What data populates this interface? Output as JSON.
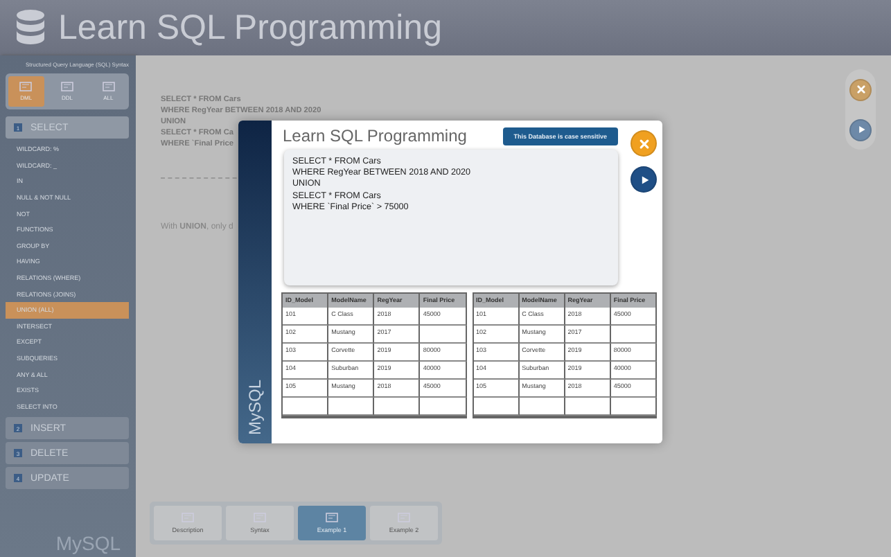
{
  "header": {
    "title": "Learn SQL Programming"
  },
  "sidebar": {
    "caption": "Structured Query Language (SQL) Syntax",
    "segments": [
      {
        "label": "DML",
        "selected": true
      },
      {
        "label": "DDL",
        "selected": false
      },
      {
        "label": "ALL",
        "selected": false
      }
    ],
    "sections": [
      {
        "number": "1",
        "label": "SELECT",
        "expanded": true,
        "items": [
          {
            "label": "WILDCARD: %",
            "selected": false
          },
          {
            "label": "WILDCARD: _",
            "selected": false
          },
          {
            "label": "IN",
            "selected": false
          },
          {
            "label": "NULL  &  NOT NULL",
            "selected": false
          },
          {
            "label": "NOT",
            "selected": false
          },
          {
            "label": "FUNCTIONS",
            "selected": false
          },
          {
            "label": "GROUP BY",
            "selected": false
          },
          {
            "label": "HAVING",
            "selected": false
          },
          {
            "label": "RELATIONS (WHERE)",
            "selected": false
          },
          {
            "label": "RELATIONS (JOINS)",
            "selected": false
          },
          {
            "label": "UNION (ALL)",
            "selected": true
          },
          {
            "label": "INTERSECT",
            "selected": false
          },
          {
            "label": "EXCEPT",
            "selected": false
          },
          {
            "label": "SUBQUERIES",
            "selected": false
          },
          {
            "label": "ANY  &  ALL",
            "selected": false
          },
          {
            "label": "EXISTS",
            "selected": false
          },
          {
            "label": "SELECT INTO",
            "selected": false
          }
        ]
      },
      {
        "number": "2",
        "label": "INSERT",
        "expanded": false
      },
      {
        "number": "3",
        "label": "DELETE",
        "expanded": false
      },
      {
        "number": "4",
        "label": "UPDATE",
        "expanded": false
      }
    ],
    "footer": "MySQL"
  },
  "main": {
    "code": [
      "SELECT * FROM Cars",
      "WHERE RegYear BETWEEN 2018 AND 2020",
      "UNION",
      "SELECT * FROM Ca",
      "WHERE `Final Price"
    ],
    "description": "With **UNION**, only d",
    "tabs": [
      {
        "label": "Description",
        "selected": false
      },
      {
        "label": "Syntax",
        "selected": false
      },
      {
        "label": "Example 1",
        "selected": true
      },
      {
        "label": "Example 2",
        "selected": false
      }
    ]
  },
  "modal": {
    "side_label": "MySQL",
    "title": "Learn SQL Programming",
    "badge": "This Database is case sensitive",
    "code": [
      "SELECT * FROM Cars",
      "WHERE RegYear BETWEEN 2018 AND 2020",
      "UNION",
      "SELECT * FROM Cars",
      "WHERE `Final Price` > 75000"
    ],
    "tables": [
      {
        "columns": [
          "ID_Model",
          "ModelName",
          "RegYear",
          "Final Price"
        ],
        "rows": [
          [
            "101",
            "C Class",
            "2018",
            "45000"
          ],
          [
            "102",
            "Mustang",
            "2017",
            ""
          ],
          [
            "103",
            "Corvette",
            "2019",
            "80000"
          ],
          [
            "104",
            "Suburban",
            "2019",
            "40000"
          ],
          [
            "105",
            "Mustang",
            "2018",
            "45000"
          ]
        ]
      },
      {
        "columns": [
          "ID_Model",
          "ModelName",
          "RegYear",
          "Final Price"
        ],
        "rows": [
          [
            "101",
            "C Class",
            "2018",
            "45000"
          ],
          [
            "102",
            "Mustang",
            "2017",
            ""
          ],
          [
            "103",
            "Corvette",
            "2019",
            "80000"
          ],
          [
            "104",
            "Suburban",
            "2019",
            "40000"
          ],
          [
            "105",
            "Mustang",
            "2018",
            "45000"
          ]
        ]
      }
    ]
  }
}
